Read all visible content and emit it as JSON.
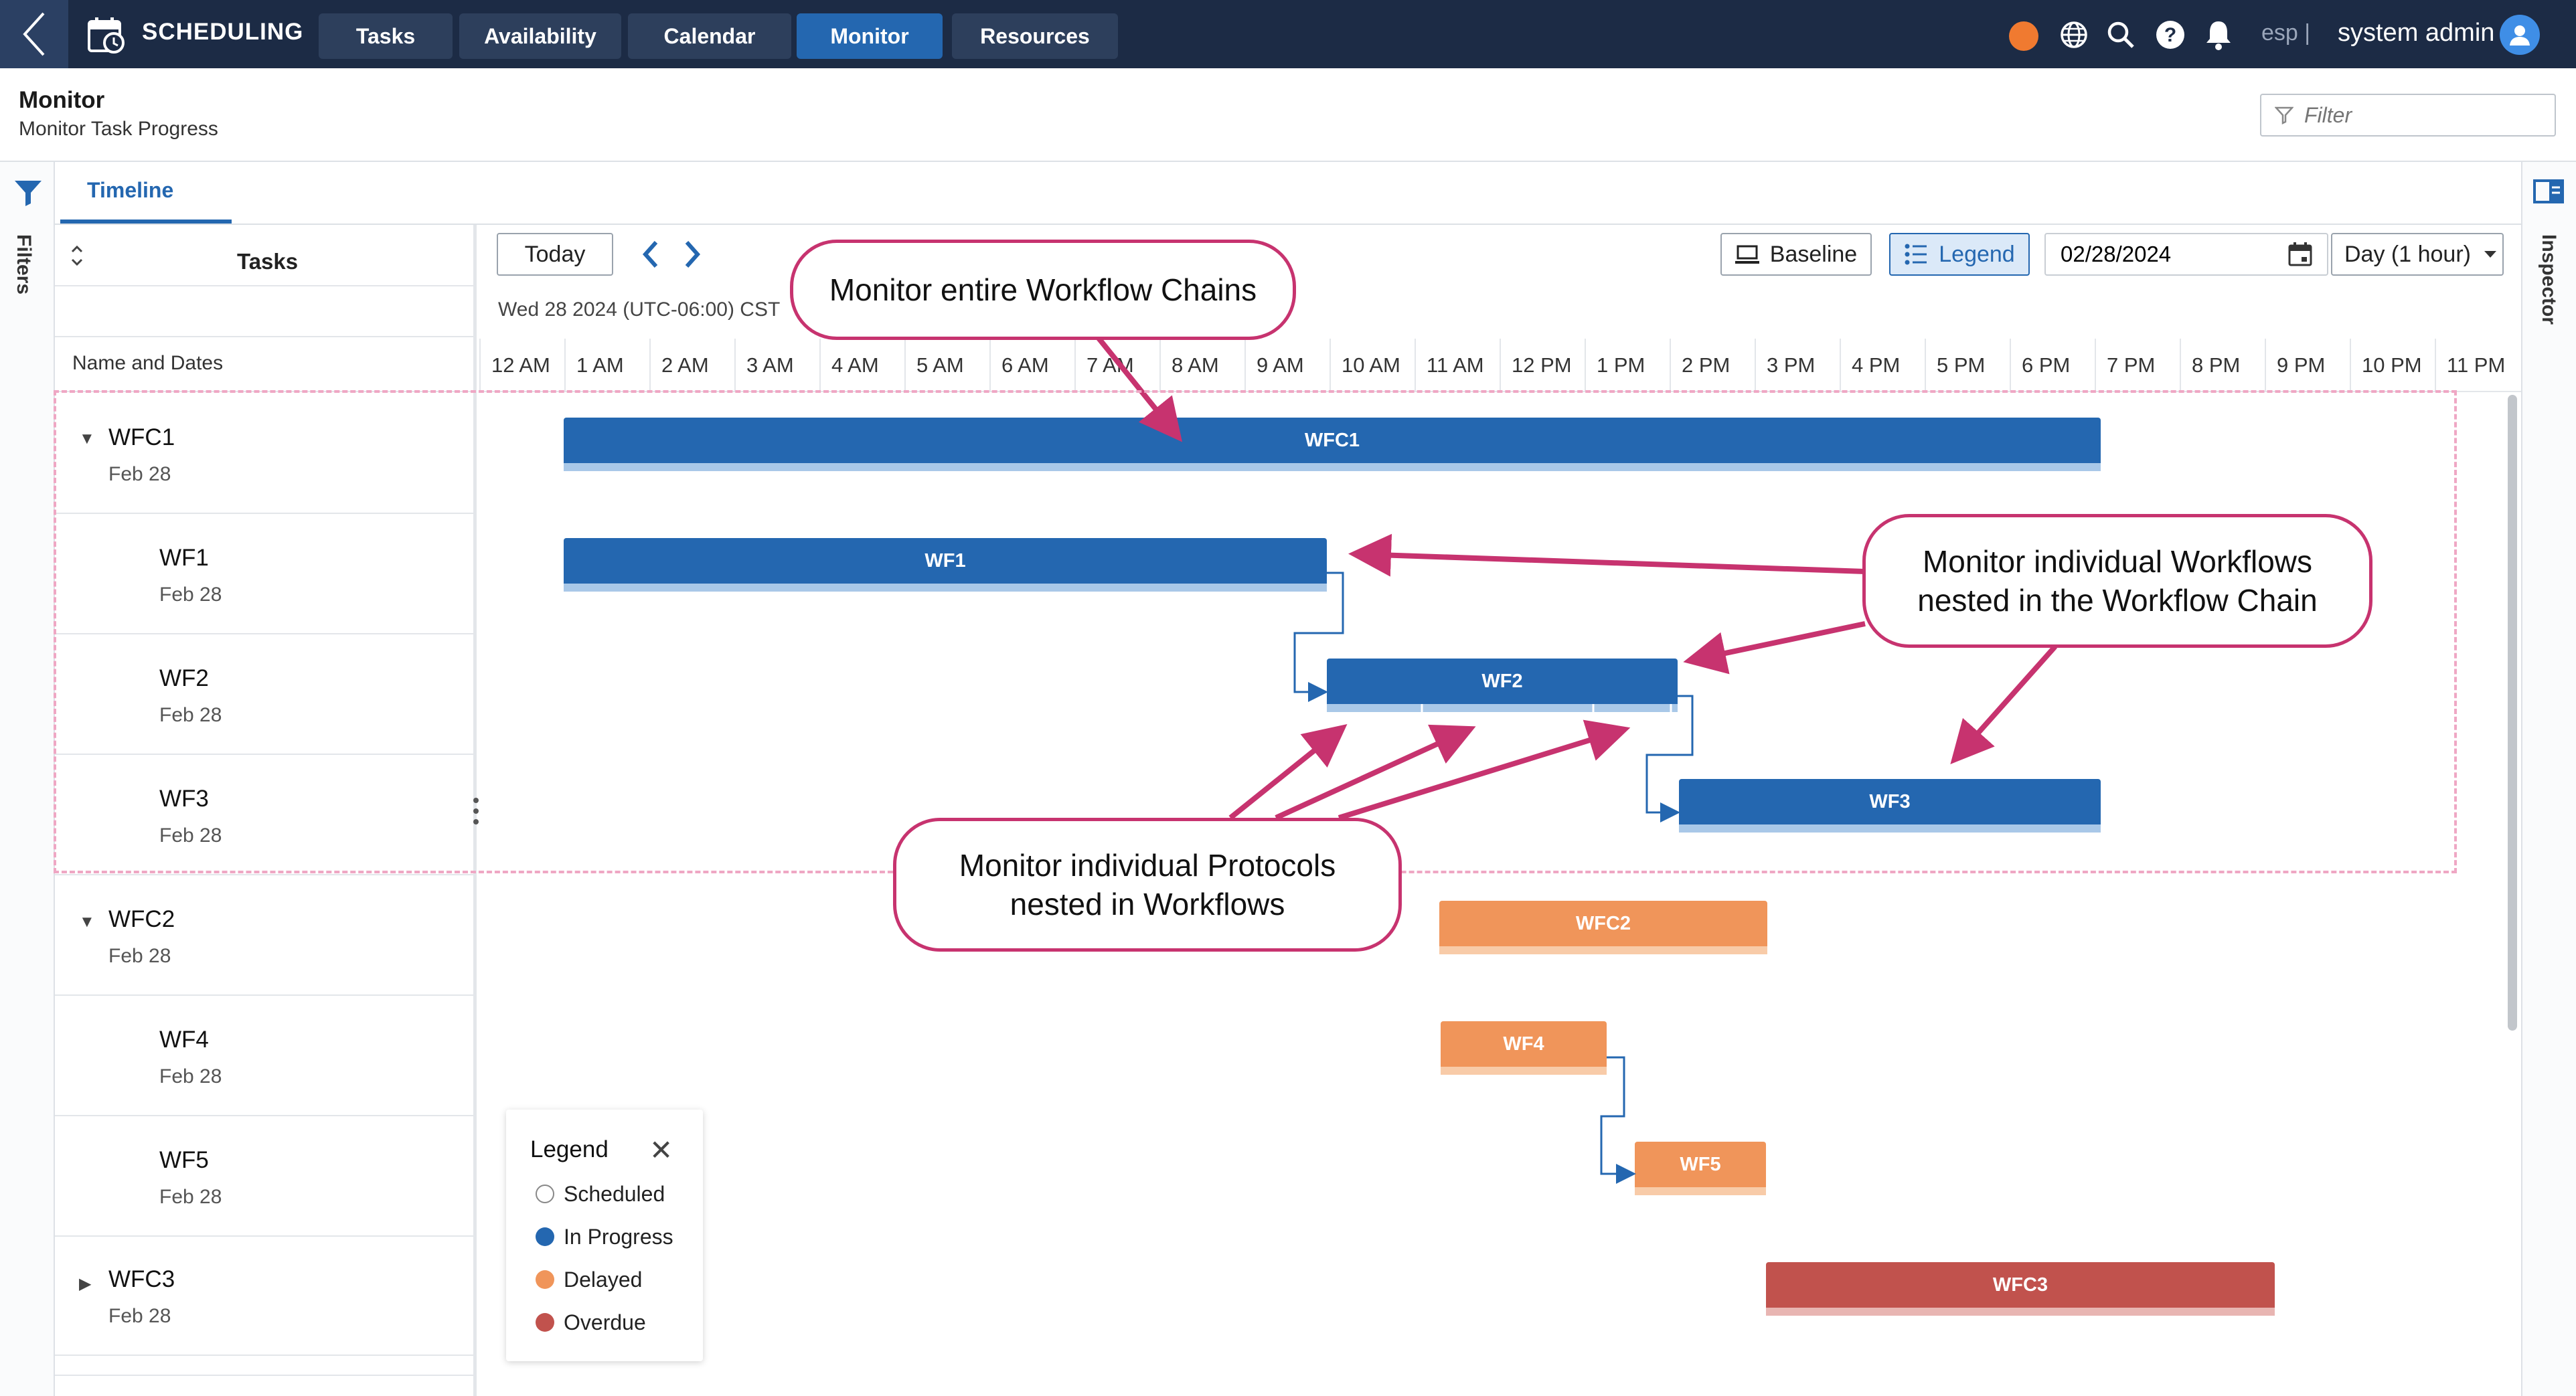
{
  "app": {
    "title": "SCHEDULING",
    "language": "esp",
    "user": "system admin"
  },
  "nav": {
    "tabs": [
      {
        "label": "Tasks",
        "active": false
      },
      {
        "label": "Availability",
        "active": false
      },
      {
        "label": "Calendar",
        "active": false
      },
      {
        "label": "Monitor",
        "active": true
      },
      {
        "label": "Resources",
        "active": false
      }
    ]
  },
  "icons": [
    "back-icon",
    "calendar-icon",
    "globe-icon",
    "search-icon",
    "help-icon",
    "bell-icon",
    "user-icon",
    "filter-icon",
    "inspector-icon",
    "sort-icon",
    "chevron-left-icon",
    "chevron-right-icon",
    "baseline-icon",
    "legend-icon",
    "calendar-picker-icon",
    "chevron-down-icon",
    "close-icon"
  ],
  "page": {
    "title": "Monitor",
    "subtitle": "Monitor Task Progress"
  },
  "filter": {
    "placeholder": "Filter",
    "value": ""
  },
  "rails": {
    "filters": "Filters",
    "inspector": "Inspector"
  },
  "view_tab": "Timeline",
  "toolbar": {
    "today": "Today",
    "baseline": "Baseline",
    "legend": "Legend",
    "date": "02/28/2024",
    "scale": "Day (1 hour)"
  },
  "timeline": {
    "date_label": "Wed 28 2024 (UTC-06:00) CST",
    "hours": [
      "12 AM",
      "1 AM",
      "2 AM",
      "3 AM",
      "4 AM",
      "5 AM",
      "6 AM",
      "7 AM",
      "8 AM",
      "9 AM",
      "10 AM",
      "11 AM",
      "12 PM",
      "1 PM",
      "2 PM",
      "3 PM",
      "4 PM",
      "5 PM",
      "6 PM",
      "7 PM",
      "8 PM",
      "9 PM",
      "10 PM",
      "11 PM"
    ]
  },
  "tasks_panel": {
    "header": "Tasks",
    "column": "Name and Dates",
    "rows": [
      {
        "name": "WFC1",
        "date": "Feb 28",
        "expanded": true
      },
      {
        "name": "WF1",
        "date": "Feb 28"
      },
      {
        "name": "WF2",
        "date": "Feb 28"
      },
      {
        "name": "WF3",
        "date": "Feb 28"
      },
      {
        "name": "WFC2",
        "date": "Feb 28",
        "expanded": true
      },
      {
        "name": "WF4",
        "date": "Feb 28"
      },
      {
        "name": "WF5",
        "date": "Feb 28"
      },
      {
        "name": "WFC3",
        "date": "Feb 28",
        "expanded": false
      }
    ]
  },
  "bars": [
    {
      "label": "WFC1",
      "status": "In Progress"
    },
    {
      "label": "WF1",
      "status": "In Progress"
    },
    {
      "label": "WF2",
      "status": "In Progress"
    },
    {
      "label": "WF3",
      "status": "In Progress"
    },
    {
      "label": "WFC2",
      "status": "Delayed"
    },
    {
      "label": "WF4",
      "status": "Delayed"
    },
    {
      "label": "WF5",
      "status": "Delayed"
    },
    {
      "label": "WFC3",
      "status": "Overdue"
    }
  ],
  "annotations": {
    "chains": "Monitor entire Workflow Chains",
    "workflows_1": "Monitor individual Workflows",
    "workflows_2": "nested in the Workflow Chain",
    "protocols_1": "Monitor individual Protocols",
    "protocols_2": "nested in Workflows"
  },
  "legend": {
    "title": "Legend",
    "items": [
      {
        "label": "Scheduled",
        "color": "#ffffff"
      },
      {
        "label": "In Progress",
        "color": "#2467b0"
      },
      {
        "label": "Delayed",
        "color": "#f0955a"
      },
      {
        "label": "Overdue",
        "color": "#c1524d"
      }
    ]
  },
  "colors": {
    "topbar": "#1c2b45",
    "accent": "#2467b0",
    "active_tab": "#2467b0",
    "callout": "#c7336f",
    "status_dot": "#f07a30"
  }
}
